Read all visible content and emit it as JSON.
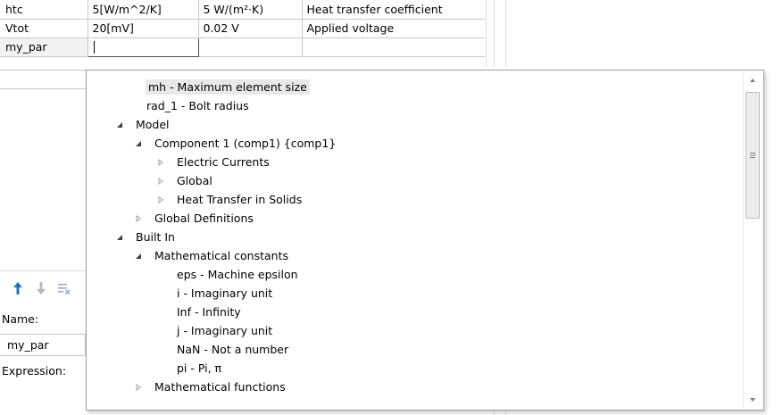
{
  "parameters": {
    "rows": [
      {
        "name": "htc",
        "expression": "5[W/m^2/K]",
        "value": "5 W/(m²·K)",
        "description": "Heat transfer coefficient"
      },
      {
        "name": "Vtot",
        "expression": "20[mV]",
        "value": "0.02 V",
        "description": "Applied voltage"
      },
      {
        "name": "my_par",
        "expression": "",
        "value": "",
        "description": ""
      }
    ]
  },
  "settings": {
    "name_label": "Name:",
    "name_value": "my_par",
    "expression_label": "Expression:",
    "toolbar_icons": [
      "move-up-icon",
      "move-down-icon",
      "delete-icon"
    ]
  },
  "completion_popup": {
    "items": [
      {
        "label": "mh - Maximum element size",
        "expander": "none",
        "selected": true
      },
      {
        "label": "rad_1 - Bolt radius",
        "expander": "none"
      },
      {
        "label": "Model",
        "expander": "expanded"
      },
      {
        "label": "Component 1 (comp1) {comp1}",
        "expander": "expanded"
      },
      {
        "label": "Electric Currents",
        "expander": "collapsed"
      },
      {
        "label": "Global",
        "expander": "collapsed"
      },
      {
        "label": "Heat Transfer in Solids",
        "expander": "collapsed"
      },
      {
        "label": "Global Definitions",
        "expander": "collapsed"
      },
      {
        "label": "Built In",
        "expander": "expanded"
      },
      {
        "label": "Mathematical constants",
        "expander": "expanded"
      },
      {
        "label": "eps - Machine epsilon",
        "expander": "none"
      },
      {
        "label": "i - Imaginary unit",
        "expander": "none"
      },
      {
        "label": "Inf - Infinity",
        "expander": "none"
      },
      {
        "label": "j - Imaginary unit",
        "expander": "none"
      },
      {
        "label": "NaN - Not a number",
        "expander": "none"
      },
      {
        "label": "pi - Pi, π",
        "expander": "none"
      },
      {
        "label": "Mathematical functions",
        "expander": "collapsed"
      }
    ]
  },
  "colors": {
    "accent_arrow": "#1a73c8",
    "selection": "#e8e8e8"
  }
}
